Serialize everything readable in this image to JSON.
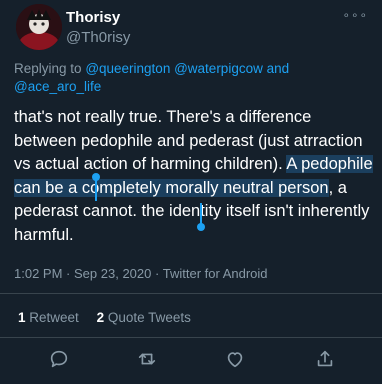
{
  "author": {
    "display_name": "Thorisy",
    "handle": "@Th0risy"
  },
  "reply_context": {
    "prefix": "Replying to",
    "mentions": [
      "@queerington",
      "@waterpigcow",
      "and",
      "@ace_aro_life"
    ]
  },
  "tweet": {
    "part1": "that's not really true. There's a difference between pedophile and pederast (just atrraction vs actual action of harming children). ",
    "selected": "A pedophile can be a completely morally neutral person",
    "part2": ", a pederast cannot. the identity itself isn't inherently harmful."
  },
  "meta": {
    "time": "1:02 PM",
    "date": "Sep 23, 2020",
    "source": "Twitter for Android",
    "separator": "·"
  },
  "stats": {
    "retweets_count": "1",
    "retweets_label": "Retweet",
    "quotes_count": "2",
    "quotes_label": "Quote Tweets"
  },
  "more_icon": "∘∘∘",
  "icons": [
    "more-icon",
    "reply-icon",
    "retweet-icon",
    "like-icon",
    "share-icon"
  ],
  "colors": {
    "background": "#15202b",
    "accent": "#1da1f2",
    "muted": "#8899a6",
    "selection": "#1b3f5e"
  }
}
